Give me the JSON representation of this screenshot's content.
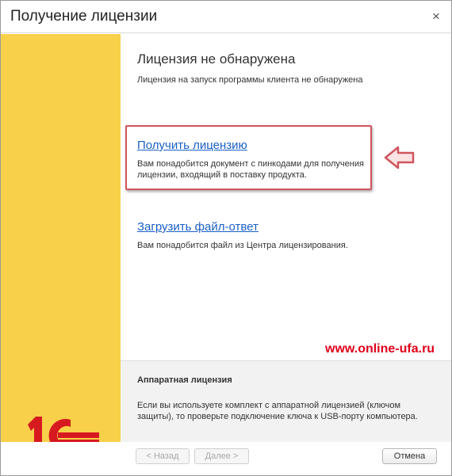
{
  "window": {
    "title": "Получение лицензии",
    "close_glyph": "×"
  },
  "main": {
    "heading": "Лицензия не обнаружена",
    "subheading": "Лицензия на запуск программы клиента не обнаружена",
    "options": [
      {
        "label": "Получить лицензию",
        "description": "Вам понадобится документ с пинкодами для получения лицензии, входящий в поставку продукта."
      },
      {
        "label": "Загрузить файл-ответ",
        "description": "Вам понадобится файл из Центра лицензирования."
      }
    ]
  },
  "watermark": "www.online-ufa.ru",
  "hardware": {
    "title": "Аппаратная лицензия",
    "text": "Если вы используете комплект с аппаратной лицензией (ключом защиты), то проверьте подключение ключа к USB-порту компьютера."
  },
  "buttons": {
    "back": "< Назад",
    "next": "Далее >",
    "cancel": "Отмена"
  },
  "colors": {
    "sidebar": "#f8d04a",
    "link": "#1a5fc4",
    "logo_red": "#d71920",
    "highlight": "#d0555d",
    "watermark": "#e0001b"
  },
  "icons": {
    "logo": "1c-logo-icon",
    "arrow": "left-arrow-icon",
    "close": "close-icon"
  }
}
